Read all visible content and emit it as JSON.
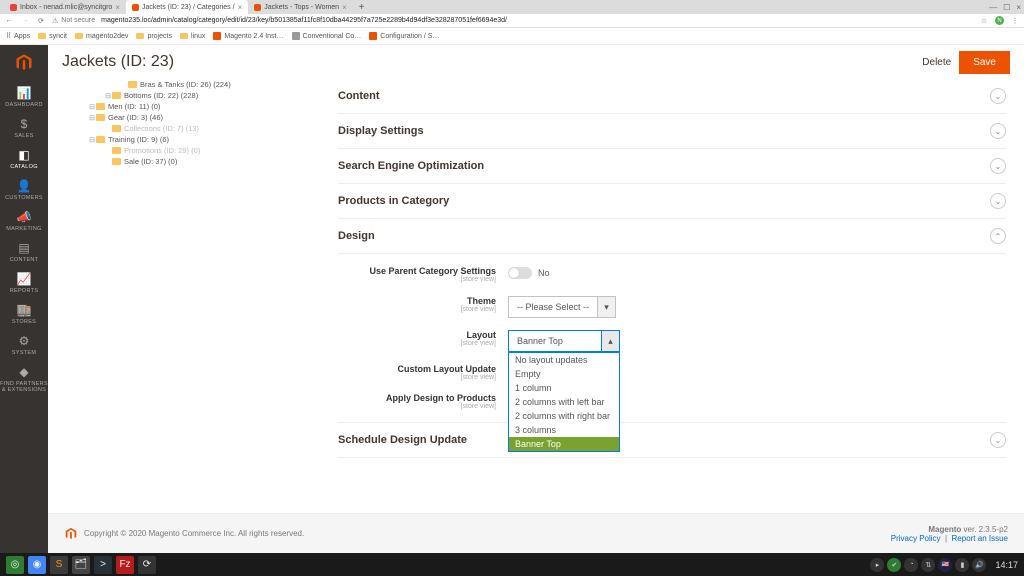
{
  "browser": {
    "tabs": [
      {
        "title": "Inbox - nenad.mlic@syncitgro",
        "favicon_color": "#ea4335"
      },
      {
        "title": "Jackets (ID: 23) / Categories /",
        "favicon_color": "#eb5202",
        "active": true
      },
      {
        "title": "Jackets - Tops - Women",
        "favicon_color": "#eb5202"
      }
    ],
    "not_secure": "Not secure",
    "url": "magento235.loc/admin/catalog/category/edit/id/23/key/b501385af11fc8f10dba44295f7a725e2289b4d94df3e328287051fef6694e3d/",
    "apps_label": "Apps",
    "bookmarks": [
      {
        "type": "folder",
        "label": "syncit"
      },
      {
        "type": "folder",
        "label": "magento2dev"
      },
      {
        "type": "folder",
        "label": "projects"
      },
      {
        "type": "folder",
        "label": "linux"
      },
      {
        "type": "mage",
        "label": "Magento 2.4 Inst…"
      },
      {
        "type": "link",
        "label": "Conventional Co…"
      },
      {
        "type": "mage",
        "label": "Configuration / S…"
      }
    ]
  },
  "sidebar": {
    "items": [
      {
        "icon": "📊",
        "label": "DASHBOARD"
      },
      {
        "icon": "$",
        "label": "SALES"
      },
      {
        "icon": "◧",
        "label": "CATALOG",
        "active": true
      },
      {
        "icon": "👤",
        "label": "CUSTOMERS"
      },
      {
        "icon": "📣",
        "label": "MARKETING"
      },
      {
        "icon": "▤",
        "label": "CONTENT"
      },
      {
        "icon": "📈",
        "label": "REPORTS"
      },
      {
        "icon": "🏬",
        "label": "STORES"
      },
      {
        "icon": "⚙",
        "label": "SYSTEM"
      },
      {
        "icon": "◆",
        "label": "FIND PARTNERS & EXTENSIONS"
      }
    ]
  },
  "page": {
    "title": "Jackets (ID: 23)",
    "delete": "Delete",
    "save": "Save"
  },
  "tree": [
    {
      "indent": 56,
      "label": "Bras & Tanks (ID: 26) (224)"
    },
    {
      "indent": 40,
      "expander": "⊟",
      "label": "Bottoms (ID: 22) (228)"
    },
    {
      "indent": 24,
      "expander": "⊟",
      "label": "Men (ID: 11) (0)"
    },
    {
      "indent": 24,
      "expander": "⊟",
      "label": "Gear (ID: 3) (46)"
    },
    {
      "indent": 40,
      "label": "Collections (ID: 7) (13)",
      "dim": true
    },
    {
      "indent": 24,
      "expander": "⊟",
      "label": "Training (ID: 9) (6)"
    },
    {
      "indent": 40,
      "label": "Promotions (ID: 29) (0)",
      "dim": true
    },
    {
      "indent": 40,
      "label": "Sale (ID: 37) (0)"
    }
  ],
  "sections": {
    "content": "Content",
    "display": "Display Settings",
    "seo": "Search Engine Optimization",
    "products": "Products in Category",
    "design": "Design",
    "schedule": "Schedule Design Update"
  },
  "design": {
    "use_parent_label": "Use Parent Category Settings",
    "use_parent_value": "No",
    "theme_label": "Theme",
    "theme_value": "-- Please Select --",
    "layout_label": "Layout",
    "layout_value": "Banner Top",
    "layout_options": [
      "No layout updates",
      "Empty",
      "1 column",
      "2 columns with left bar",
      "2 columns with right bar",
      "3 columns",
      "Banner Top"
    ],
    "layout_selected_index": 6,
    "clu_label": "Custom Layout Update",
    "adtp_label": "Apply Design to Products",
    "scope": "[store view]"
  },
  "footer": {
    "copyright": "Copyright © 2020 Magento Commerce Inc. All rights reserved.",
    "version_label": "Magento",
    "version": "ver. 2.3.5-p2",
    "privacy": "Privacy Policy",
    "report": "Report an Issue"
  },
  "os": {
    "clock": "14:17",
    "launchers": [
      {
        "name": "mint-menu",
        "bg": "#2e7d32",
        "glyph": "◎"
      },
      {
        "name": "chrome",
        "bg": "#4285f4",
        "glyph": "◉"
      },
      {
        "name": "sublime",
        "bg": "#3b3b3b",
        "glyph": "S",
        "color": "#ff9800"
      },
      {
        "name": "files",
        "bg": "#444",
        "glyph": "🗂"
      },
      {
        "name": "terminal",
        "bg": "#263238",
        "glyph": ">"
      },
      {
        "name": "filezilla",
        "bg": "#b71c1c",
        "glyph": "Fz"
      },
      {
        "name": "updates",
        "bg": "#333",
        "glyph": "⟳"
      }
    ]
  }
}
